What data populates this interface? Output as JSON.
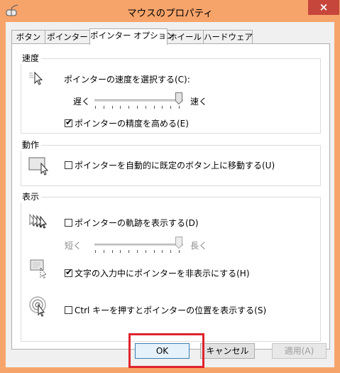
{
  "window": {
    "title": "マウスのプロパティ",
    "close_label": "×",
    "frame_color": "#f7a46b"
  },
  "tabs": [
    {
      "label": "ボタン",
      "active": false
    },
    {
      "label": "ポインター",
      "active": false
    },
    {
      "label": "ポインター オプション",
      "active": true
    },
    {
      "label": "ホイール",
      "active": false
    },
    {
      "label": "ハードウェア",
      "active": false
    }
  ],
  "motion": {
    "title": "速度",
    "speed_label": "ポインターの速度を選択する(C):",
    "slow_label": "遅く",
    "fast_label": "速く",
    "speed_level": 1.0,
    "precision_label": "ポインターの精度を高める(E)",
    "precision_checked": true
  },
  "snap": {
    "title": "動作",
    "snap_label": "ポインターを自動的に既定のボタン上に移動する(U)",
    "snap_checked": false
  },
  "visibility": {
    "title": "表示",
    "trails_label": "ポインターの軌跡を表示する(D)",
    "trails_checked": false,
    "short_label": "短く",
    "long_label": "長く",
    "trails_level": 1.0,
    "hide_label": "文字の入力中にポインターを非表示にする(H)",
    "hide_checked": true,
    "ctrl_label": "Ctrl キーを押すとポインターの位置を表示する(S)",
    "ctrl_checked": false
  },
  "buttons": {
    "ok": "OK",
    "cancel": "キャンセル",
    "apply": "適用(A)"
  },
  "colors": {
    "highlight": "#e0242d",
    "accent": "#3c7fb1"
  }
}
